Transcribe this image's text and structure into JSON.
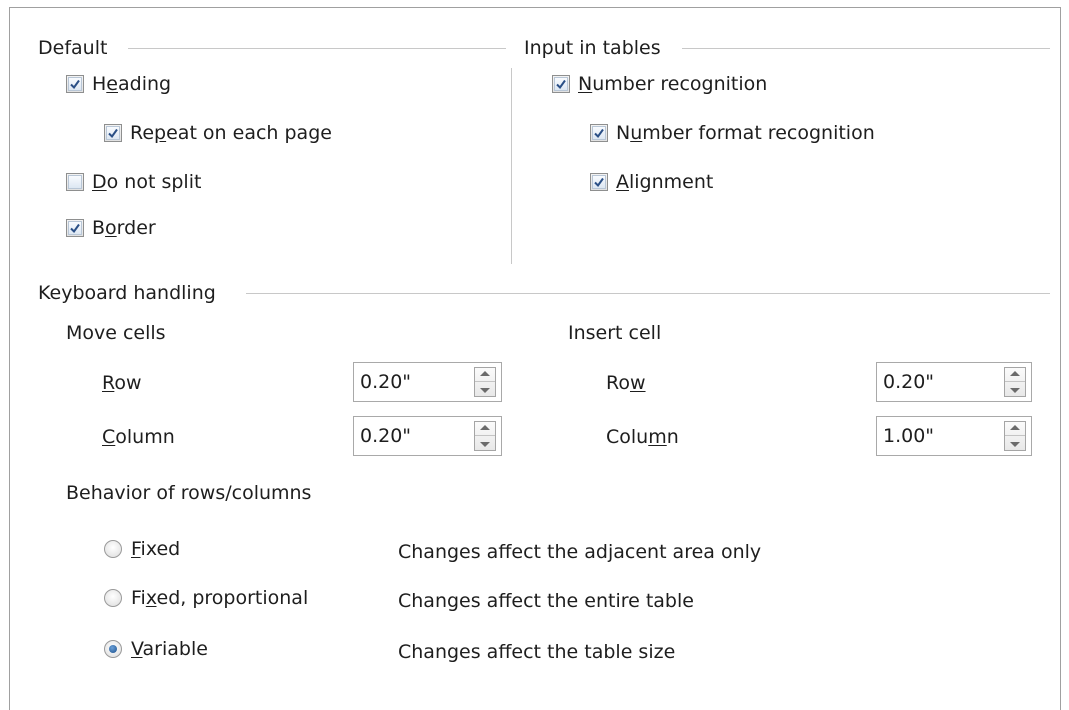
{
  "default_section": {
    "title": "Default",
    "heading": {
      "pre": "H",
      "mnemonic": "e",
      "post": "ading",
      "checked": true
    },
    "repeat_on_each_page": {
      "pre": "Re",
      "mnemonic": "p",
      "post": "eat on each page",
      "checked": true
    },
    "do_not_split": {
      "pre": "",
      "mnemonic": "D",
      "post": "o not split",
      "checked": false
    },
    "border": {
      "pre": "B",
      "mnemonic": "o",
      "post": "rder",
      "checked": true
    }
  },
  "input_in_tables": {
    "title": "Input in tables",
    "number_recognition": {
      "pre": "",
      "mnemonic": "N",
      "post": "umber recognition",
      "checked": true
    },
    "number_format_recognition": {
      "pre": "N",
      "mnemonic": "u",
      "post": "mber format recognition",
      "checked": true
    },
    "alignment": {
      "pre": "",
      "mnemonic": "A",
      "post": "lignment",
      "checked": true
    }
  },
  "keyboard_handling": {
    "title": "Keyboard handling",
    "move_cells": {
      "title": "Move cells",
      "row": {
        "pre": "",
        "mnemonic": "R",
        "post": "ow",
        "value": "0.20\""
      },
      "column": {
        "pre": "",
        "mnemonic": "C",
        "post": "olumn",
        "value": "0.20\""
      }
    },
    "insert_cell": {
      "title": "Insert cell",
      "row": {
        "pre": "Ro",
        "mnemonic": "w",
        "post": "",
        "value": "0.20\""
      },
      "column": {
        "pre": "Colu",
        "mnemonic": "m",
        "post": "n",
        "value": "1.00\""
      }
    },
    "behavior": {
      "title": "Behavior of rows/columns",
      "fixed": {
        "pre": "",
        "mnemonic": "F",
        "post": "ixed",
        "desc": "Changes affect the adjacent area only",
        "selected": false
      },
      "fixed_proportional": {
        "pre": "Fi",
        "mnemonic": "x",
        "post": "ed, proportional",
        "desc": "Changes affect the entire table",
        "selected": false
      },
      "variable": {
        "pre": "",
        "mnemonic": "V",
        "post": "ariable",
        "desc": "Changes affect the table size",
        "selected": true
      }
    }
  }
}
